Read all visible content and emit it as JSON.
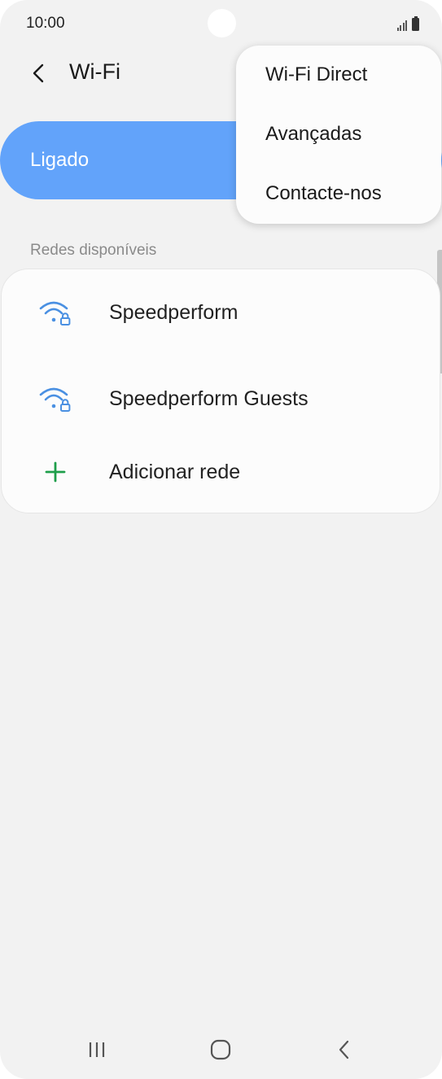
{
  "status_bar": {
    "time": "10:00",
    "signal_icon": "signal-icon",
    "battery_icon": "battery-icon"
  },
  "header": {
    "back_icon": "back-arrow-icon",
    "title": "Wi-Fi"
  },
  "master_toggle": {
    "label": "Ligado",
    "color": "#62a3fa"
  },
  "networks": {
    "section_title": "Redes disponíveis",
    "items": [
      {
        "name": "Speedperform",
        "icon": "wifi-locked-icon"
      },
      {
        "name": "Speedperform Guests",
        "icon": "wifi-locked-icon"
      }
    ],
    "add_network": {
      "label": "Adicionar rede",
      "icon": "plus-icon",
      "icon_color": "#1e9e4a"
    },
    "wifi_icon_color": "#4a90e2"
  },
  "popup_menu": {
    "items": [
      {
        "label": "Wi-Fi Direct"
      },
      {
        "label": "Avançadas"
      },
      {
        "label": "Contacte-nos"
      }
    ]
  },
  "nav_bar": {
    "recents_icon": "recents-icon",
    "home_icon": "home-icon",
    "back_icon": "back-icon"
  }
}
